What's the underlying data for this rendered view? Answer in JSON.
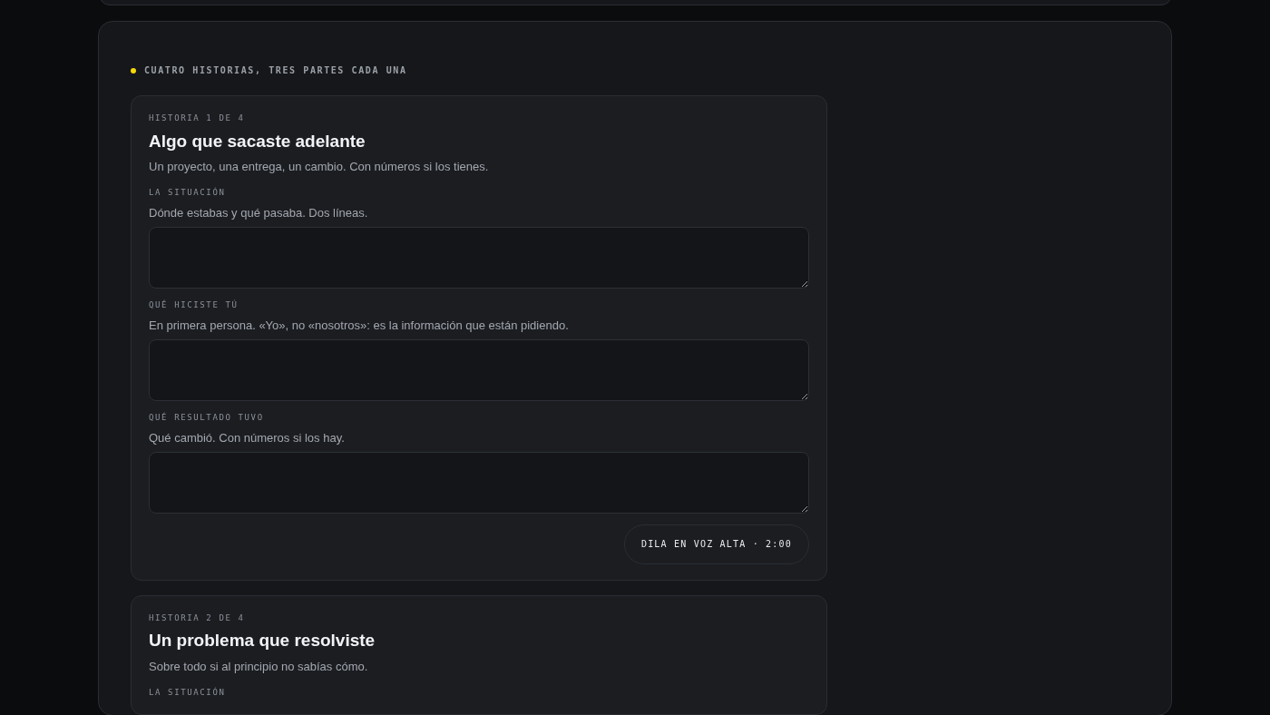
{
  "section": {
    "title": "CUATRO HISTORIAS, TRES PARTES CADA UNA"
  },
  "stories": [
    {
      "counter": "HISTORIA 1 DE 4",
      "title": "Algo que sacaste adelante",
      "subtitle": "Un proyecto, una entrega, un cambio. Con números si los tienes.",
      "parts": [
        {
          "label": "LA SITUACIÓN",
          "hint": "Dónde estabas y qué pasaba. Dos líneas."
        },
        {
          "label": "QUÉ HICISTE TÚ",
          "hint": "En primera persona. «Yo», no «nosotros»: es la información que están pidiendo."
        },
        {
          "label": "QUÉ RESULTADO TUVO",
          "hint": "Qué cambió. Con números si los hay."
        }
      ],
      "button": "DILA EN VOZ ALTA · 2:00"
    },
    {
      "counter": "HISTORIA 2 DE 4",
      "title": "Un problema que resolviste",
      "subtitle": "Sobre todo si al principio no sabías cómo.",
      "parts": [
        {
          "label": "LA SITUACIÓN"
        }
      ]
    }
  ]
}
